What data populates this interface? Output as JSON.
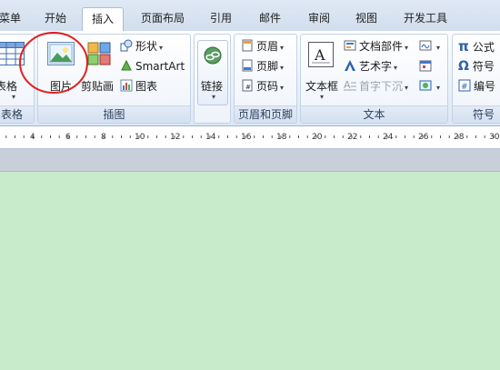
{
  "tabs": [
    {
      "label": "菜单"
    },
    {
      "label": "开始"
    },
    {
      "label": "插入"
    },
    {
      "label": "页面布局"
    },
    {
      "label": "引用"
    },
    {
      "label": "邮件"
    },
    {
      "label": "审阅"
    },
    {
      "label": "视图"
    },
    {
      "label": "开发工具"
    }
  ],
  "active_tab": "插入",
  "groups": {
    "tables": {
      "label": "表格",
      "table_button": "表格"
    },
    "illustrations": {
      "label": "插图",
      "picture": "图片",
      "clipart": "剪贴画",
      "shapes": "形状",
      "smartart": "SmartArt",
      "chart": "图表"
    },
    "links": {
      "label": "",
      "link": "链接"
    },
    "header_footer": {
      "label": "页眉和页脚",
      "header": "页眉",
      "footer": "页脚",
      "page_number": "页码"
    },
    "text": {
      "label": "文本",
      "textbox": "文本框",
      "quickparts": "文档部件",
      "wordart": "艺术字",
      "dropcap": "首字下沉"
    },
    "symbols": {
      "label": "符号",
      "equation": "公式",
      "symbol": "符号",
      "numbering": "编号",
      "pi": "π",
      "omega": "Ω"
    }
  },
  "ruler": {
    "numbers": [
      "4",
      "6",
      "8",
      "10",
      "12",
      "14",
      "16",
      "18",
      "20",
      "22",
      "24",
      "26",
      "28",
      "30"
    ]
  },
  "colors": {
    "highlight_circle": "#e02020",
    "document_bg": "#c7ebcb"
  }
}
